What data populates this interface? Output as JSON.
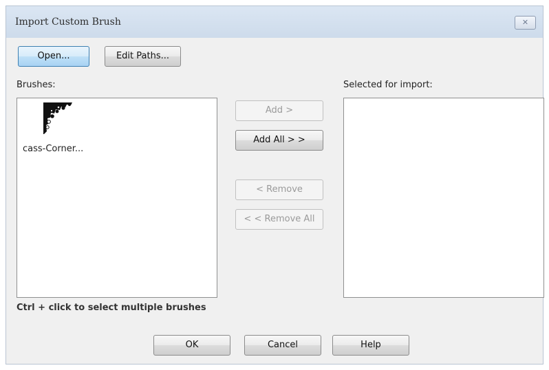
{
  "window": {
    "title": "Import Custom Brush",
    "close_label": "✕"
  },
  "toolbar": {
    "open_label": "Open...",
    "edit_paths_label": "Edit Paths..."
  },
  "brushes": {
    "label": "Brushes:",
    "items": [
      {
        "name": "cass-Corner..."
      }
    ],
    "hint": "Ctrl + click to select multiple brushes"
  },
  "transfer": {
    "add_label": "Add >",
    "add_all_label": "Add All > >",
    "remove_label": "< Remove",
    "remove_all_label": "< < Remove All"
  },
  "selected": {
    "label": "Selected for import:"
  },
  "footer": {
    "ok_label": "OK",
    "cancel_label": "Cancel",
    "help_label": "Help"
  }
}
